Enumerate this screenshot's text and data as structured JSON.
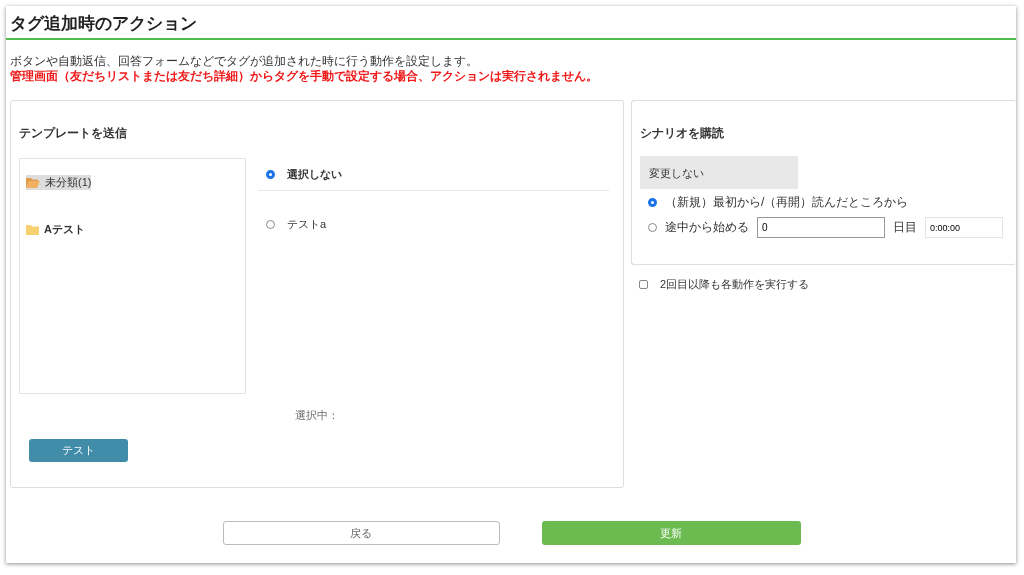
{
  "header": {
    "title": "タグ追加時のアクション"
  },
  "notes": [
    "ボタンや自動返信、回答フォームなどでタグが追加された時に行う動作を設定します。",
    "管理画面（友だちリストまたは友だち詳細）からタグを手動で設定する場合、アクションは実行されません。"
  ],
  "template_panel": {
    "title": "テンプレートを送信",
    "folders": [
      {
        "label": "未分類(1)",
        "selected": true,
        "expanded": true
      },
      {
        "label": "Aテスト",
        "selected": false,
        "expanded": false
      }
    ],
    "templates": [
      {
        "label": "選択しない",
        "selected": true
      },
      {
        "label": "テストa",
        "selected": false
      }
    ],
    "selection_label": "選択中：",
    "test_button": "テスト"
  },
  "scenario_panel": {
    "title": "シナリオを購読",
    "dropdown": "変更しない",
    "options": [
      {
        "kind": "plain",
        "label": "（新規）最初から/（再開）読んだところから",
        "selected": true
      },
      {
        "kind": "offset",
        "label": "途中から始める",
        "selected": false,
        "day_value": "0",
        "day_unit": "日目",
        "time_value": "0:00:00"
      }
    ]
  },
  "repeat_checkbox": {
    "label": "2回目以降も各動作を実行する",
    "checked": false
  },
  "buttons": {
    "back": "戻る",
    "update": "更新"
  }
}
